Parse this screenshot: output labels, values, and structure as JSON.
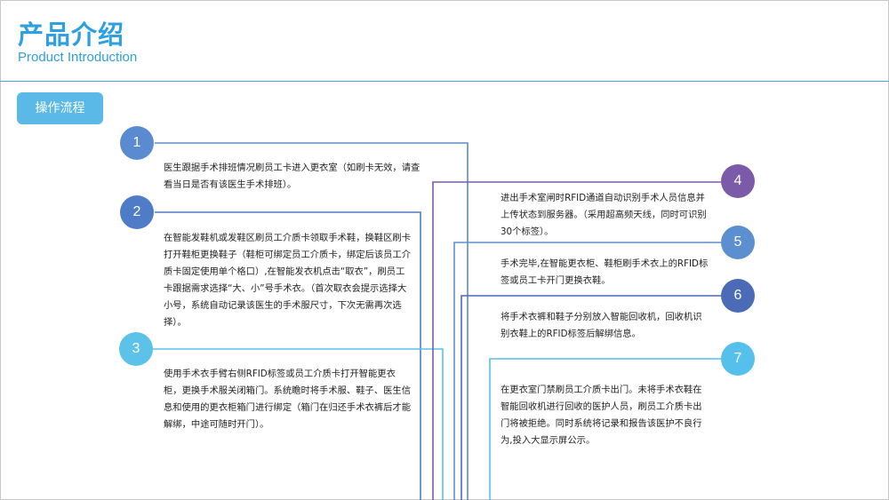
{
  "header": {
    "title_cn": "产品介绍",
    "title_en": "Product Introduction"
  },
  "section_tag": "操作流程",
  "colors": {
    "accent": "#2e9fe0",
    "step1": "#5a8bd1",
    "step2": "#4e7cc7",
    "step3": "#5cc2ea",
    "step4": "#7b5aa9",
    "step5": "#5b8fd0",
    "step6": "#4c6bb7",
    "step7": "#55c0ec"
  },
  "steps": [
    {
      "num": "1",
      "text": "医生跟据手术排班情况刷员工卡进入更衣室（如刷卡无效，请查看当日是否有该医生手术排班）。"
    },
    {
      "num": "2",
      "text": "在智能发鞋机或发鞋区刷员工介质卡领取手术鞋，换鞋区刷卡打开鞋柜更换鞋子（鞋柜可绑定员工介质卡，绑定后该员工介质卡固定使用单个格口）,在智能发衣机点击“取衣”，刷员工卡跟据需求选择“大、小”号手术衣。（首次取衣会提示选择大小号，系统自动记录该医生的手术服尺寸，下次无需再次选择）。"
    },
    {
      "num": "3",
      "text": "使用手术衣手臂右侧RFID标签或员工介质卡打开智能更衣柜，更换手术服关闭箱门。系统瞻时将手术服、鞋子、医生信息和使用的更衣柜箱门进行绑定（箱门在归还手术衣裤后才能解绑，中途可随时开门）。"
    },
    {
      "num": "4",
      "text": "进出手术室闸时RFID通道自动识别手术人员信息并上传状态到服务器。（采用超高频天线，同时可识别30个标签）。"
    },
    {
      "num": "5",
      "text": "手术完毕,在智能更衣柜、鞋柜刷手术衣上的RFID标签或员工卡开门更换衣鞋。"
    },
    {
      "num": "6",
      "text": "将手术衣裤和鞋子分别放入智能回收机，回收机识别衣鞋上的RFID标签后解绑信息。"
    },
    {
      "num": "7",
      "text": "在更衣室门禁刷员工介质卡出门。未将手术衣鞋在智能回收机进行回收的医护人员，刷员工介质卡出门将被拒绝。同时系统将记录和报告该医护不良行为,投入大显示屏公示。"
    }
  ]
}
